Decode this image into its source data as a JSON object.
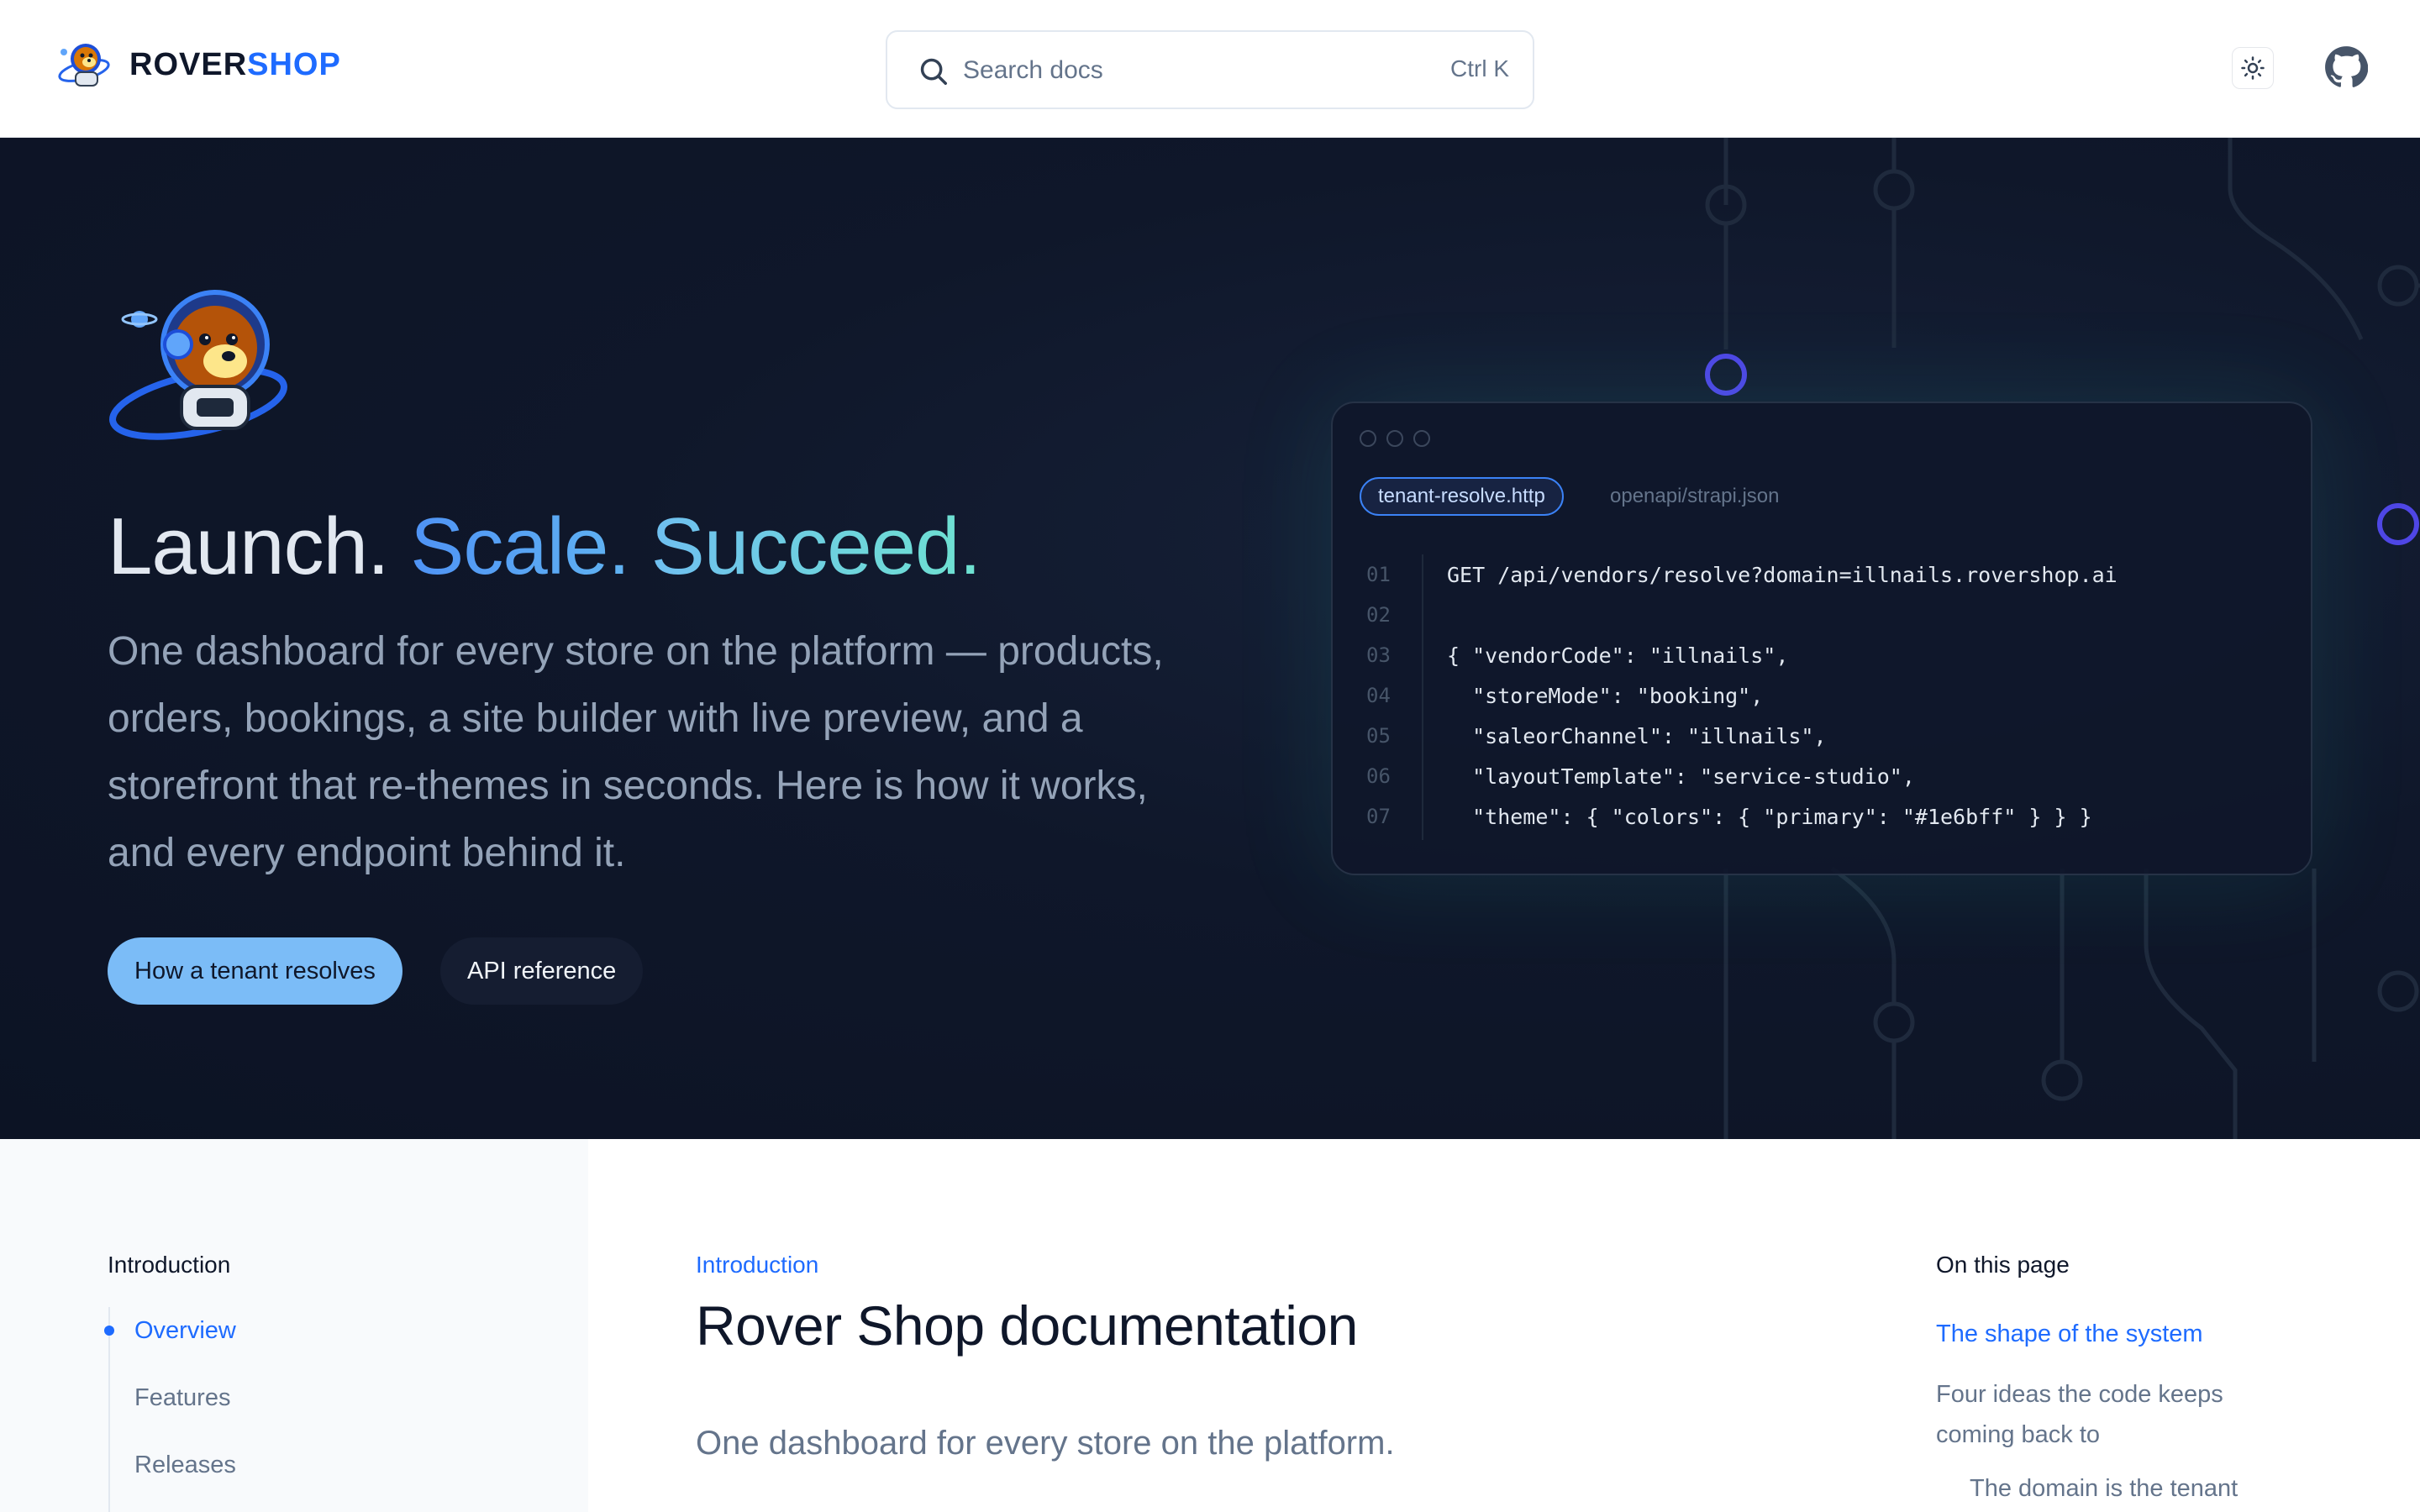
{
  "brand": {
    "name_a": "ROVER",
    "name_b": "SHOP",
    "accent": "#1e6bff"
  },
  "search": {
    "placeholder": "Search docs",
    "shortcut": "Ctrl K"
  },
  "header_icons": [
    "sun-icon",
    "github-icon"
  ],
  "hero": {
    "title_1": "Launch.",
    "title_2": "Scale.",
    "title_3": "Succeed.",
    "description": "One dashboard for every store on the platform — products, orders, bookings, a site builder with live preview, and a storefront that re-themes in seconds. Here is how it works, and every endpoint behind it.",
    "primary_cta": "How a tenant resolves",
    "secondary_cta": "API reference"
  },
  "code_card": {
    "tabs": [
      "tenant-resolve.http",
      "openapi/strapi.json"
    ],
    "lines": [
      {
        "n": "01",
        "text": "GET /api/vendors/resolve?domain=illnails.rovershop.ai"
      },
      {
        "n": "02",
        "text": ""
      },
      {
        "n": "03",
        "text": "{ \"vendorCode\": \"illnails\","
      },
      {
        "n": "04",
        "text": "  \"storeMode\": \"booking\","
      },
      {
        "n": "05",
        "text": "  \"saleorChannel\": \"illnails\","
      },
      {
        "n": "06",
        "text": "  \"layoutTemplate\": \"service-studio\","
      },
      {
        "n": "07",
        "text": "  \"theme\": { \"colors\": { \"primary\": \"#1e6bff\" } } }"
      }
    ]
  },
  "sidebar": {
    "heading": "Introduction",
    "items": [
      {
        "label": "Overview",
        "active": true
      },
      {
        "label": "Features",
        "active": false
      },
      {
        "label": "Releases",
        "active": false
      }
    ]
  },
  "main": {
    "eyebrow": "Introduction",
    "title": "Rover Shop documentation",
    "lede": "One dashboard for every store on the platform."
  },
  "toc": {
    "heading": "On this page",
    "items": [
      {
        "label": "The shape of the system",
        "active": true
      },
      {
        "label": "Four ideas the code keeps coming back to",
        "active": false
      },
      {
        "label": "The domain is the tenant",
        "active": false
      }
    ]
  }
}
